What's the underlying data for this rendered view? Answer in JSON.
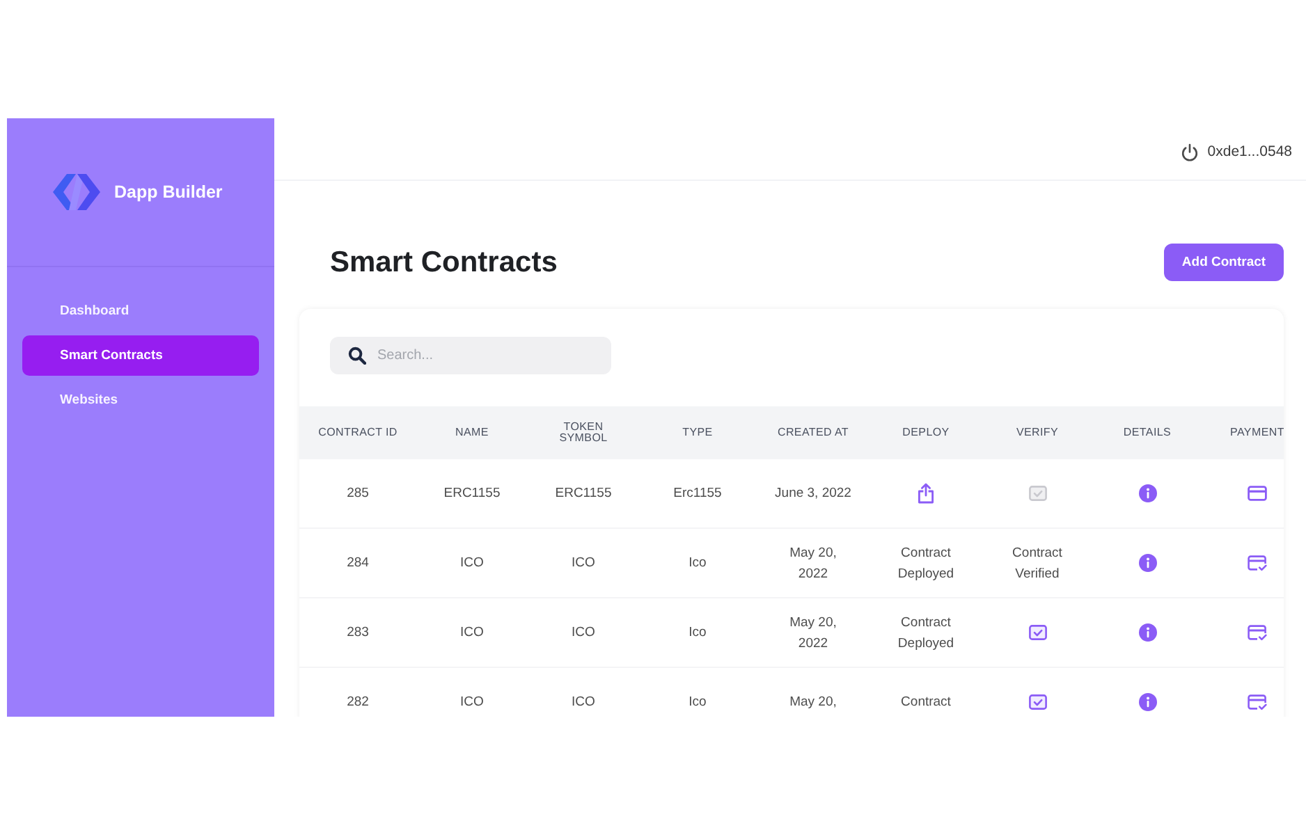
{
  "sidebar": {
    "brand": "Dapp Builder",
    "nav": [
      {
        "label": "Dashboard",
        "selected": false
      },
      {
        "label": "Smart Contracts",
        "selected": true
      },
      {
        "label": "Websites",
        "selected": false
      }
    ]
  },
  "header": {
    "account": "0xde1...0548"
  },
  "page": {
    "title": "Smart Contracts",
    "add_button": "Add Contract"
  },
  "search": {
    "placeholder": "Search..."
  },
  "table": {
    "columns": [
      "CONTRACT ID",
      "NAME",
      "TOKEN SYMBOL",
      "TYPE",
      "CREATED AT",
      "DEPLOY",
      "VERIFY",
      "DETAILS",
      "PAYMENT"
    ],
    "rows": [
      {
        "contract_id": "285",
        "name": "ERC1155",
        "token_symbol": "ERC1155",
        "type": "Erc1155",
        "created_at": "June 3, 2022",
        "deploy": {
          "kind": "button"
        },
        "verify": {
          "kind": "button",
          "disabled": true
        },
        "paid": false
      },
      {
        "contract_id": "284",
        "name": "ICO",
        "token_symbol": "ICO",
        "type": "Ico",
        "created_at": "May 20, 2022",
        "deploy": {
          "kind": "status",
          "text": "Contract Deployed"
        },
        "verify": {
          "kind": "status",
          "text": "Contract Verified"
        },
        "paid": true
      },
      {
        "contract_id": "283",
        "name": "ICO",
        "token_symbol": "ICO",
        "type": "Ico",
        "created_at": "May 20, 2022",
        "deploy": {
          "kind": "status",
          "text": "Contract Deployed"
        },
        "verify": {
          "kind": "button",
          "disabled": false
        },
        "paid": true
      },
      {
        "contract_id": "282",
        "name": "ICO",
        "token_symbol": "ICO",
        "type": "Ico",
        "created_at": "May 20,",
        "deploy": {
          "kind": "status",
          "text": "Contract"
        },
        "verify": {
          "kind": "button",
          "disabled": false
        },
        "paid": true
      }
    ]
  }
}
